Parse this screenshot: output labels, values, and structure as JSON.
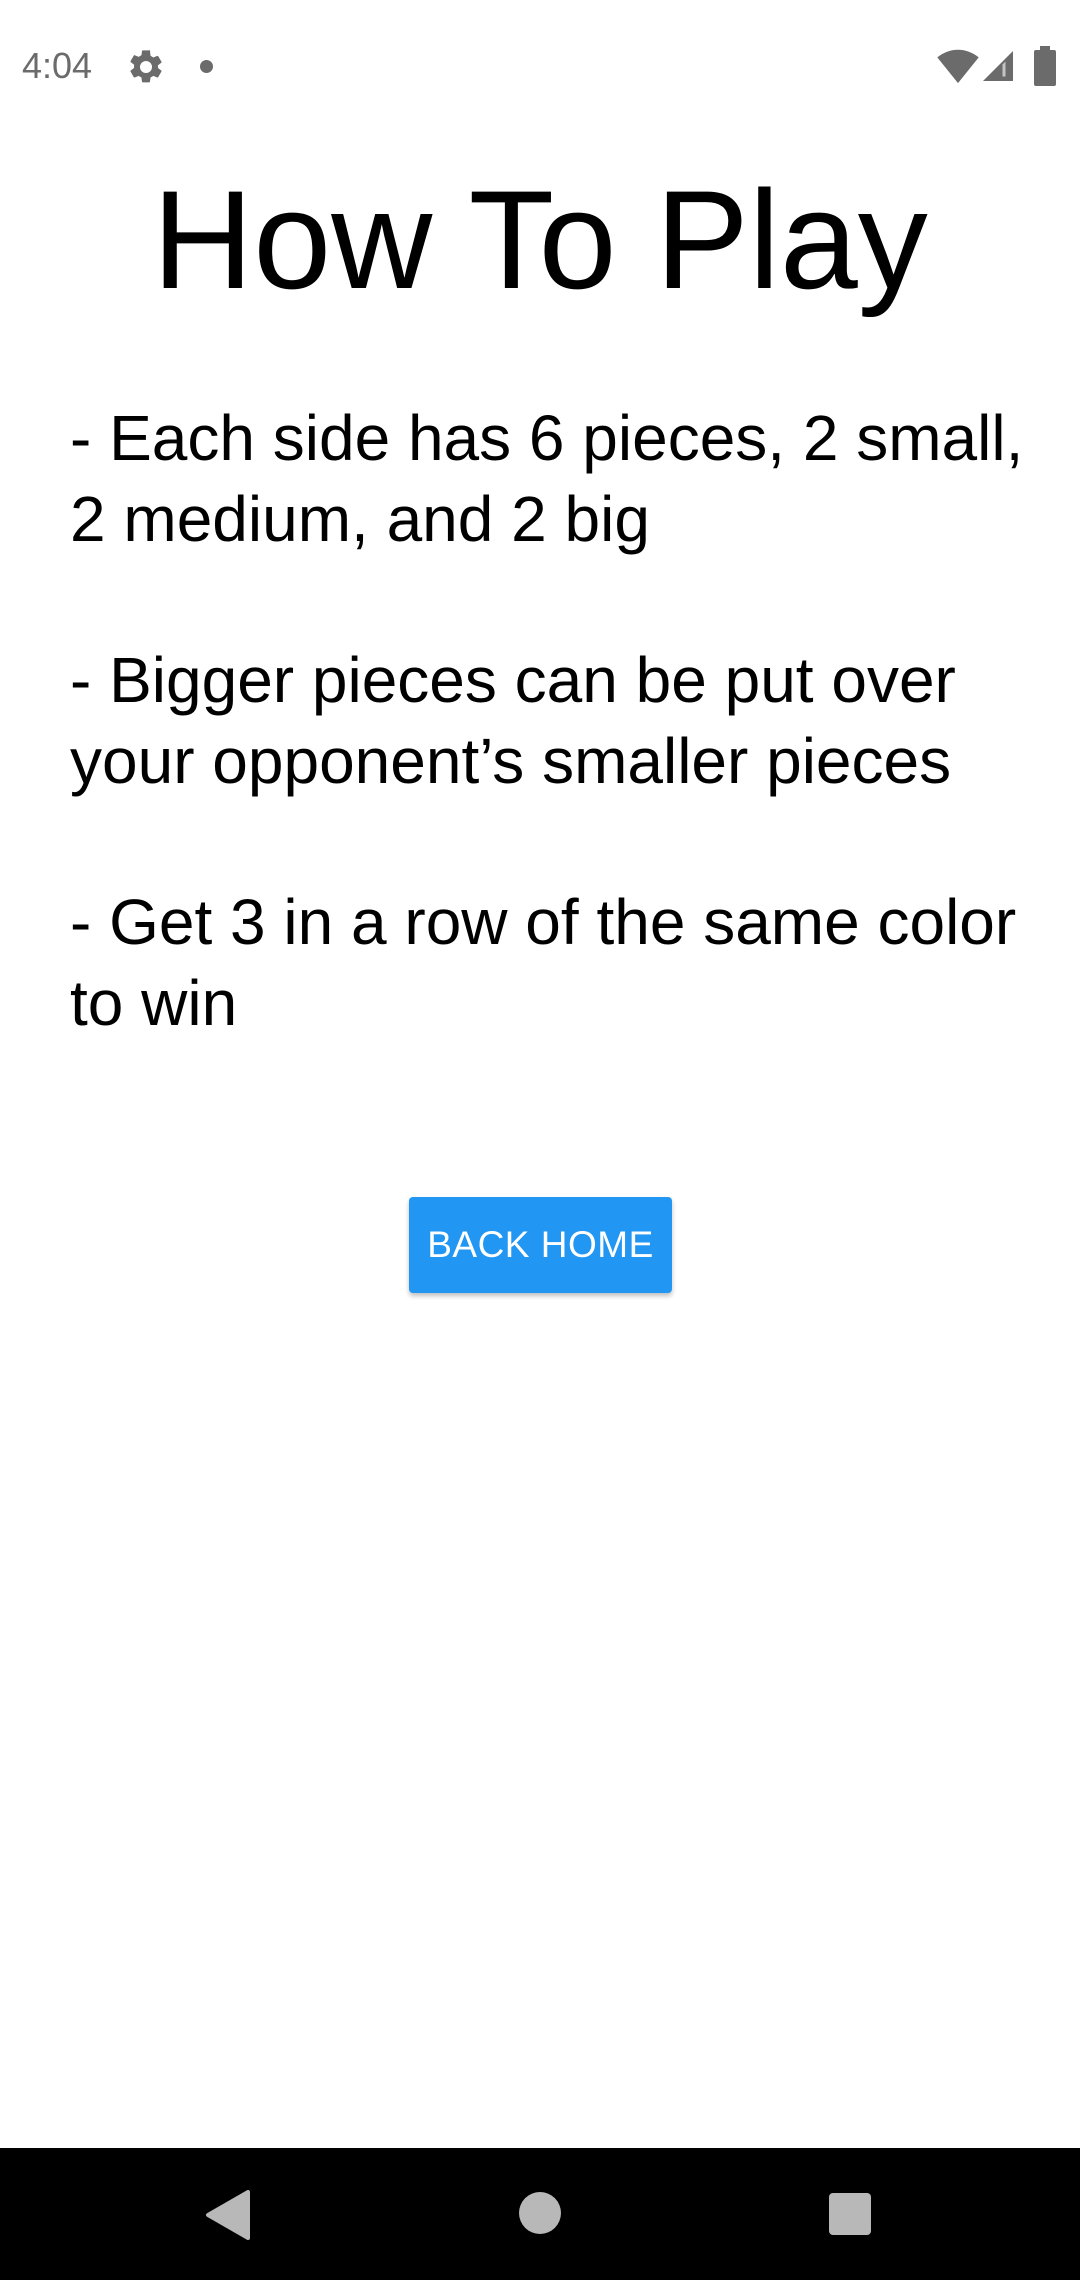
{
  "status_bar": {
    "time": "4:04",
    "icons": [
      "gear-icon",
      "notification-dot-icon",
      "wifi-icon",
      "cell-signal-icon",
      "battery-icon"
    ]
  },
  "page": {
    "title": "How To Play",
    "rules": [
      "- Each side has 6 pieces, 2 small, 2 medium, and 2 big",
      "- Bigger pieces can be put over your opponent’s smaller pieces",
      "- Get 3 in a row of the same color to win"
    ],
    "back_button_label": "BACK HOME"
  },
  "nav_bar": {
    "icons": [
      "back-icon",
      "home-icon",
      "recents-icon"
    ]
  },
  "colors": {
    "accent": "#2196f3",
    "text": "#000000",
    "background": "#ffffff",
    "nav_bar": "#000000"
  }
}
